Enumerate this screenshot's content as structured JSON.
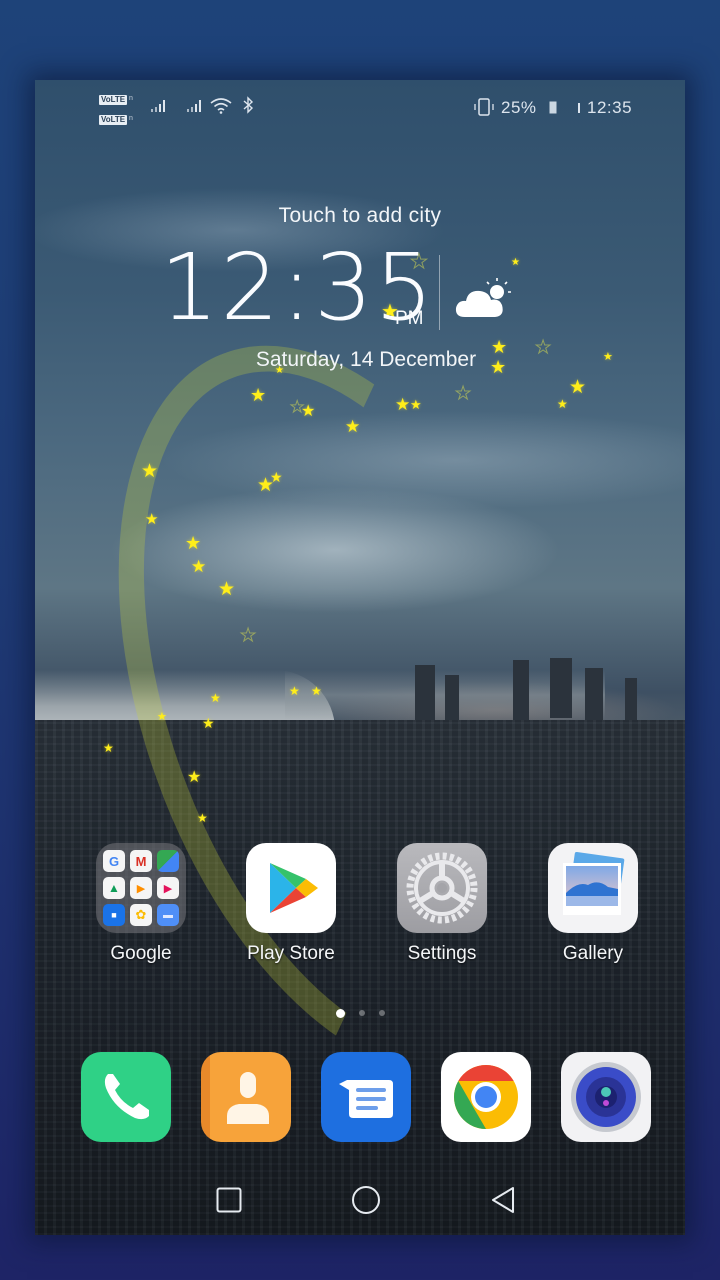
{
  "status_bar": {
    "sim1_label": "VoLTE",
    "sim2_label": "VoLTE",
    "battery_percent": "25%",
    "time": "12:35",
    "icons": [
      "volte-icon",
      "signal-icon",
      "signal-icon",
      "wifi-icon",
      "bluetooth-icon",
      "vibrate-icon",
      "battery-icon"
    ]
  },
  "clock_widget": {
    "city_prompt": "Touch to add city",
    "time": "12:35",
    "ampm": "PM",
    "date": "Saturday, 14 December",
    "weather_icon": "partly-cloudy-icon"
  },
  "home_apps": [
    {
      "label": "Google",
      "icon": "google-folder-icon",
      "type": "folder",
      "folder_apps": [
        "Google",
        "Gmail",
        "Maps",
        "Drive",
        "Play Music",
        "Play Movies",
        "Duo",
        "Photos",
        "Messages"
      ]
    },
    {
      "label": "Play Store",
      "icon": "play-store-icon"
    },
    {
      "label": "Settings",
      "icon": "settings-icon"
    },
    {
      "label": "Gallery",
      "icon": "gallery-icon"
    }
  ],
  "page_indicator": {
    "pages": 3,
    "current": 1
  },
  "dock_apps": [
    {
      "name": "Phone",
      "icon": "phone-icon",
      "color": "#2fd186"
    },
    {
      "name": "Contacts",
      "icon": "contacts-icon",
      "color": "#f59a2c"
    },
    {
      "name": "Messages",
      "icon": "messages-icon",
      "color": "#1e6fe0"
    },
    {
      "name": "Chrome",
      "icon": "chrome-icon",
      "color": "#ffffff"
    },
    {
      "name": "Camera",
      "icon": "camera-icon",
      "color": "#f2f2f4"
    }
  ],
  "nav_bar": {
    "recents": "recents-button",
    "home": "home-button",
    "back": "back-button"
  }
}
